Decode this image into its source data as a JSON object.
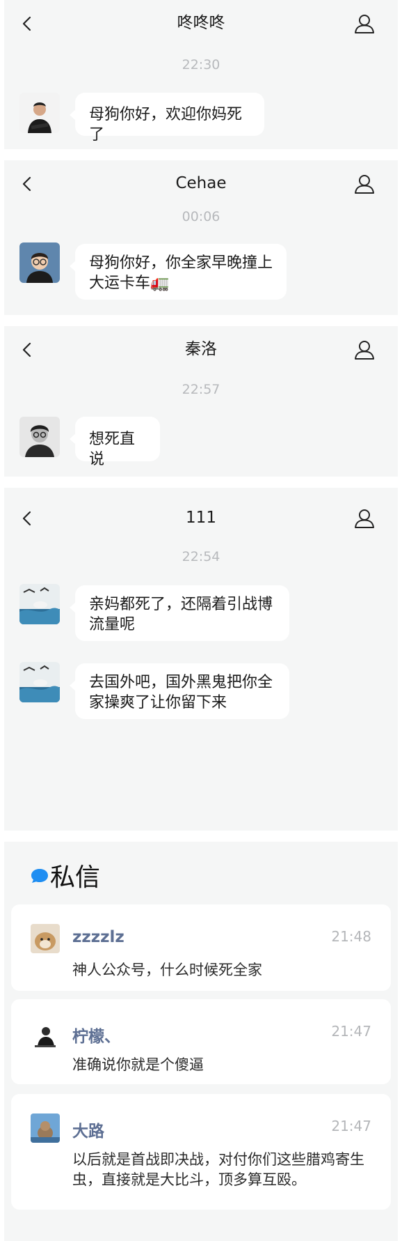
{
  "chats": [
    {
      "title": "咚咚咚",
      "time": "22:30",
      "messages": [
        "母狗你好，欢迎你妈死了"
      ]
    },
    {
      "title": "Cehae",
      "time": "00:06",
      "messages": [
        "母狗你好，你全家早晚撞上大运卡车🚛"
      ]
    },
    {
      "title": "秦洛",
      "time": "22:57",
      "messages": [
        "想死直说"
      ]
    },
    {
      "title": "111",
      "time": "22:54",
      "messages": [
        "亲妈都死了，还隔着引战博流量呢",
        "去国外吧，国外黑鬼把你全家操爽了让你留下来"
      ]
    }
  ],
  "dm": {
    "title": "私信",
    "items": [
      {
        "name": "zzzzlz",
        "time": "21:48",
        "message": "神人公众号，什么时候死全家"
      },
      {
        "name": "柠檬、",
        "time": "21:47",
        "message": "准确说你就是个傻逼"
      },
      {
        "name": "大路",
        "time": "21:47",
        "message": "以后就是首战即决战，对付你们这些腊鸡寄生虫，直接就是大比斗，顶多算互殴。"
      }
    ]
  },
  "icons": {
    "back": "chevron-left-icon",
    "user": "user-profile-icon",
    "dm": "chat-bubble-icon"
  },
  "colors": {
    "panel_bg": "#f5f6f6",
    "bubble_bg": "#ffffff",
    "name_color": "#5d6f93",
    "dm_dot": "#1f8ef2"
  }
}
